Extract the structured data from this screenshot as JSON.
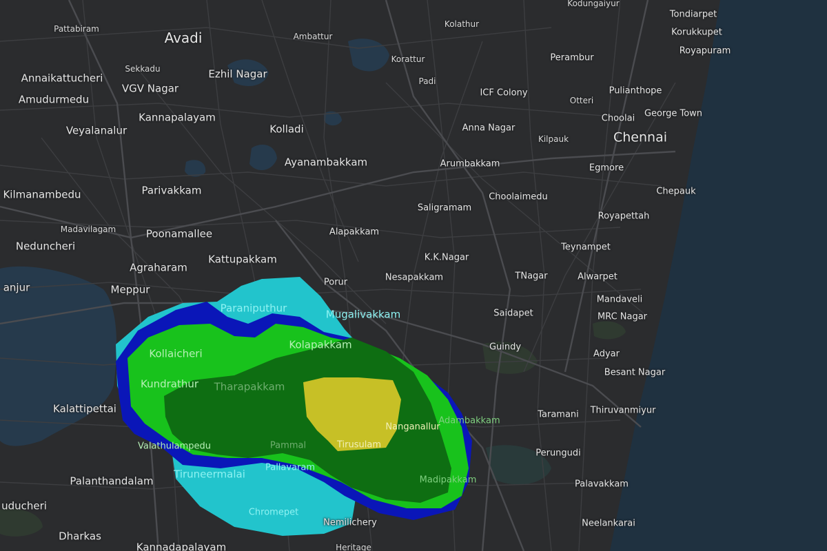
{
  "map": {
    "colors": {
      "land": "#2b2c2e",
      "sea": "#1f3140",
      "water": "#263a4c",
      "road": "#3c3d40",
      "road_major": "#4a4b4e",
      "park": "#2f3a30",
      "radar_cyan": "#22c4cc",
      "radar_blue": "#0a16b8",
      "radar_light_green": "#18c21c",
      "radar_dark_green": "#0e6e12",
      "radar_yellow": "#c7c026"
    },
    "labels": {
      "kodungaiyur": "Kodungaiyur",
      "tondiarpet": "Tondiarpet",
      "pattabiram": "Pattabiram",
      "avadi": "Avadi",
      "ambattur": "Ambattur",
      "kolathur": "Kolathur",
      "korukkupet": "Korukkupet",
      "royapuram": "Royapuram",
      "korattur": "Korattur",
      "perambur": "Perambur",
      "annaikattucheri": "Annaikattucheri",
      "sekkadu": "Sekkadu",
      "ezhil_nagar": "Ezhil Nagar",
      "padi": "Padi",
      "vgv_nagar": "VGV Nagar",
      "pulianthope": "Pulianthope",
      "icf_colony": "ICF Colony",
      "amudurmedu": "Amudurmedu",
      "otteri": "Otteri",
      "george_town": "George Town",
      "choolai": "Choolai",
      "kannapalayam": "Kannapalayam",
      "veyalanalur": "Veyalanalur",
      "kolladi": "Kolladi",
      "anna_nagar": "Anna Nagar",
      "chennai": "Chennai",
      "kilpauk": "Kilpauk",
      "ayanambakkam": "Ayanambakkam",
      "arumbakkam": "Arumbakkam",
      "egmore": "Egmore",
      "kilmanambedu": "Kilmanambedu",
      "parivakkam": "Parivakkam",
      "chepauk": "Chepauk",
      "choolaimedu": "Choolaimedu",
      "saligramam": "Saligramam",
      "royapettah": "Royapettah",
      "madavilagam": "Madavilagam",
      "poonamallee": "Poonamallee",
      "alapakkam": "Alapakkam",
      "teynampet": "Teynampet",
      "neduncheri": "Neduncheri",
      "kk_nagar": "K.K.Nagar",
      "kattupakkam": "Kattupakkam",
      "agraharam": "Agraharam",
      "nesapakkam": "Nesapakkam",
      "tnagar": "TNagar",
      "alwarpet": "Alwarpet",
      "porur": "Porur",
      "meppur": "Meppur",
      "anjur": "anjur",
      "mandaveli": "Mandaveli",
      "paraniputhur": "Paraniputhur",
      "mrc_nagar": "MRC Nagar",
      "mugalivakkam": "Mugalivakkam",
      "saidapet": "Saidapet",
      "kolapakkam": "Kolapakkam",
      "guindy": "Guindy",
      "kollaicheri": "Kollaicheri",
      "adyar": "Adyar",
      "besant_nagar": "Besant Nagar",
      "kundrathur": "Kundrathur",
      "tharapakkam": "Tharapakkam",
      "kalattipettai": "Kalattipettai",
      "taramani": "Taramani",
      "thiruvanmiyur": "Thiruvanmiyur",
      "adambakkam": "Adambakkam",
      "nanganallur": "Nanganallur",
      "valathulampedu": "Valathulampedu",
      "pammal": "Pammal",
      "tirusulam": "Tirusulam",
      "perungudi": "Perungudi",
      "tiruneermalai": "Tiruneermalai",
      "pallavaram": "Pallavaram",
      "palanthandalam": "Palanthandalam",
      "madipakkam": "Madipakkam",
      "palavakkam": "Palavakkam",
      "uducheri": "uducheri",
      "chromepet": "Chromepet",
      "nemilichery": "Nemilichery",
      "neelankarai": "Neelankarai",
      "dharkas": "Dharkas",
      "kannadapalayam": "Kannadapalayam",
      "heritage": "Heritage"
    }
  }
}
